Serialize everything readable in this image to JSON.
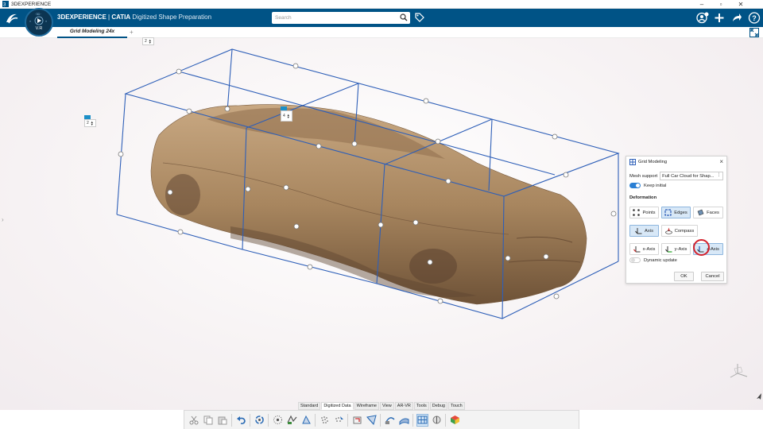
{
  "window": {
    "title": "3DEXPERIENCE",
    "controls": [
      "–",
      "▫",
      "✕"
    ]
  },
  "app": {
    "brand_bold": "3DEXPERIENCE",
    "brand_sep": " | ",
    "brand_catia": "CATIA",
    "brand_app": "Digitized Shape Preparation",
    "compass_version": "V.R"
  },
  "search": {
    "placeholder": "Search",
    "value": ""
  },
  "tabs": {
    "active": "Grid Modeling 24x",
    "add": "+"
  },
  "viewport": {
    "spin_top": "2",
    "spin_left": "2",
    "spin_center": "4",
    "colors": {
      "car": "#a8865f",
      "grid": "#2e5fb8",
      "handle": "#ffffff"
    }
  },
  "panel": {
    "title": "Grid Modeling",
    "mesh_support_label": "Mesh support",
    "mesh_support_value": "Full Car Cloud for Shap...",
    "keep_initial_label": "Keep initial",
    "keep_initial_on": true,
    "deformation_label": "Deformation",
    "btn_points": "Points",
    "btn_edges": "Edges",
    "btn_faces": "Faces",
    "btn_axis": "Axis",
    "btn_compass": "Compass",
    "btn_xaxis": "x-Axis",
    "btn_yaxis": "y-Axis",
    "btn_zaxis": "z-Axis",
    "dynamic_update_label": "Dynamic update",
    "dynamic_update_on": false,
    "ok": "OK",
    "cancel": "Cancel"
  },
  "toolbar_tabs": [
    "Standard",
    "Digitized Data",
    "Wireframe",
    "View",
    "AR-VR",
    "Tools",
    "Debug",
    "Touch"
  ],
  "toolbar_active_tab": "Digitized Data",
  "toolbar_icons": [
    "cut-icon",
    "copy-icon",
    "paste-icon",
    "undo-icon",
    "update-icon",
    "mesh-icon",
    "cloud-import-icon",
    "mesh-cleaner-icon",
    "point-cloud-icon",
    "activate-icon",
    "scan-align-icon",
    "section-icon",
    "curve-icon",
    "grid-modeling-icon",
    "analysis-icon",
    "material-icon"
  ]
}
